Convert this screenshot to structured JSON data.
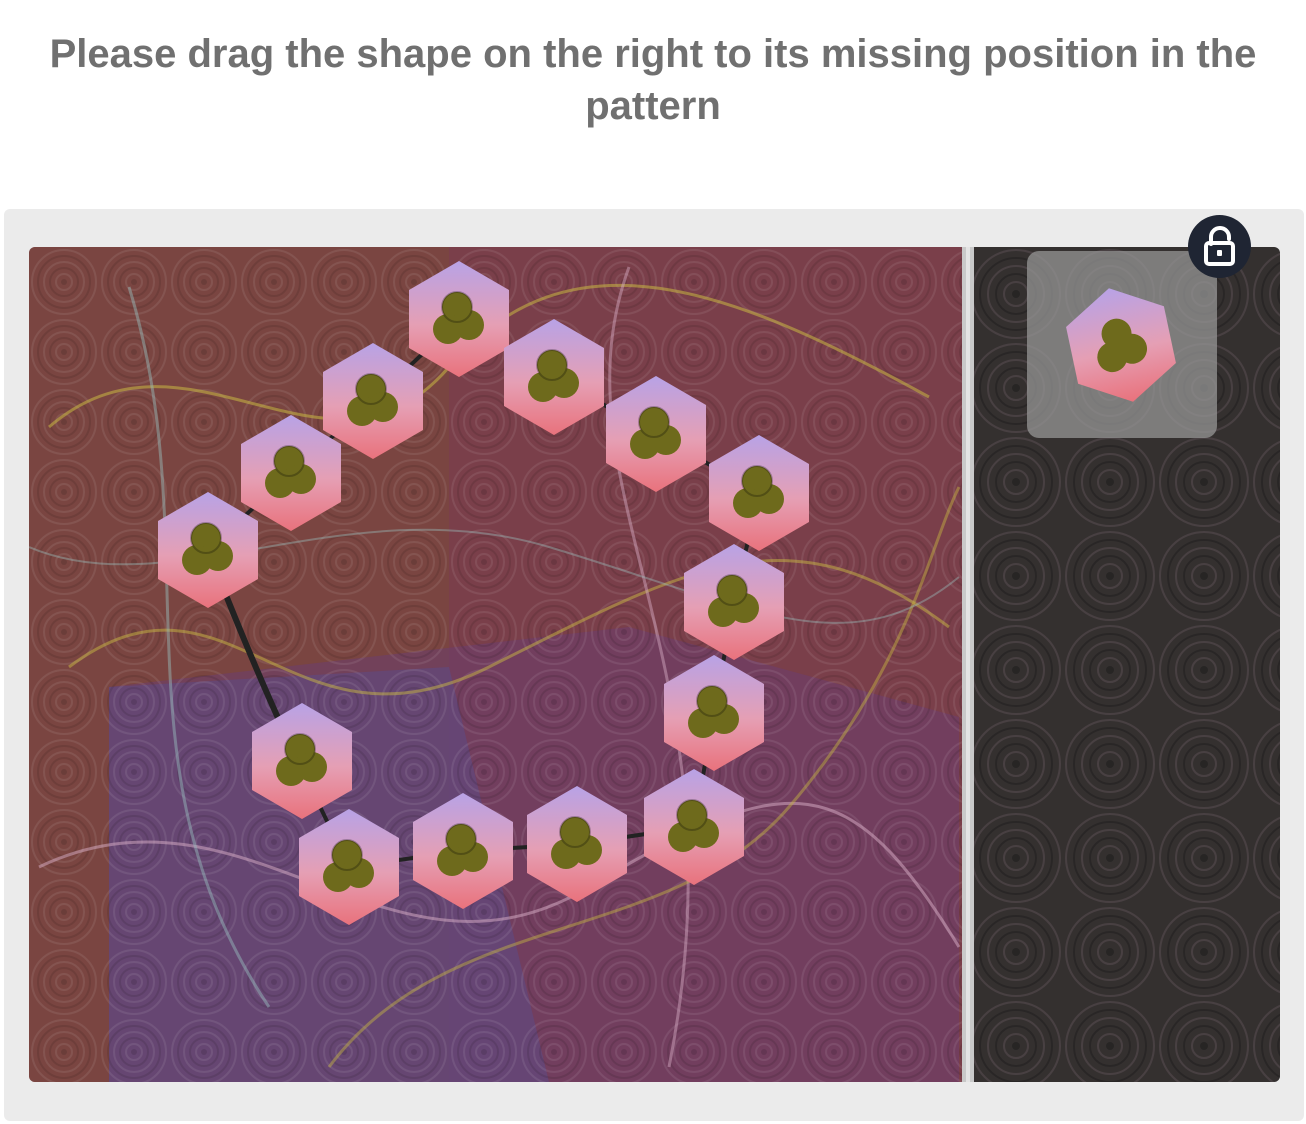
{
  "instruction": "Please drag the shape on the right to its missing position in the pattern",
  "piece_icon": "hexagon-trefoil-icon",
  "lock_icon": "lock-icon",
  "colors": {
    "frame": "#ebebeb",
    "instruction_text": "#707070",
    "board_left": "#7a3f4a",
    "board_right": "#34302f",
    "divider": "#c9c9c9",
    "hex_top": "#b8a2e6",
    "hex_bottom": "#e9727c",
    "trefoil": "#6e6a1c",
    "lock_bg": "#1f2533"
  }
}
